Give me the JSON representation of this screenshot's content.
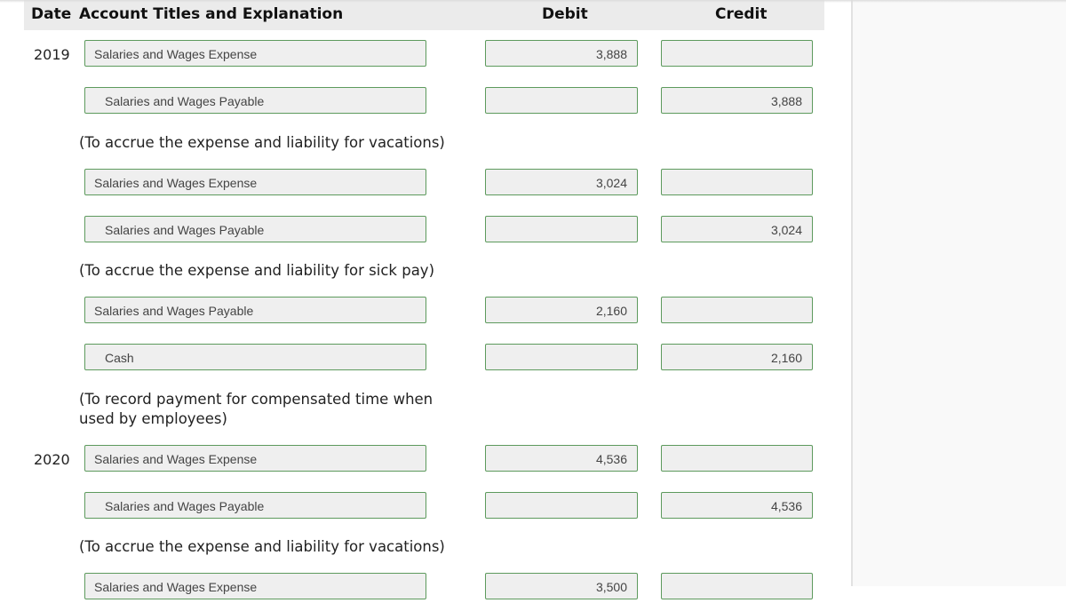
{
  "header": {
    "date": "Date",
    "account": "Account Titles and Explanation",
    "debit": "Debit",
    "credit": "Credit"
  },
  "entries": [
    {
      "date": "2019",
      "account": "Salaries and Wages Expense",
      "debit": "3,888",
      "credit": ""
    },
    {
      "date": "",
      "account": "Salaries and Wages Payable",
      "debit": "",
      "credit": "3,888"
    },
    {
      "explanation": "(To accrue the expense and liability for vacations)"
    },
    {
      "date": "",
      "account": "Salaries and Wages Expense",
      "debit": "3,024",
      "credit": ""
    },
    {
      "date": "",
      "account": "Salaries and Wages Payable",
      "debit": "",
      "credit": "3,024"
    },
    {
      "explanation": "(To accrue the expense and liability for sick pay)"
    },
    {
      "date": "",
      "account": "Salaries and Wages Payable",
      "debit": "2,160",
      "credit": ""
    },
    {
      "date": "",
      "account": "Cash",
      "debit": "",
      "credit": "2,160"
    },
    {
      "explanation": "(To record payment for compensated time when used by employees)"
    },
    {
      "date": "2020",
      "account": "Salaries and Wages Expense",
      "debit": "4,536",
      "credit": ""
    },
    {
      "date": "",
      "account": "Salaries and Wages Payable",
      "debit": "",
      "credit": "4,536"
    },
    {
      "explanation": "(To accrue the expense and liability for vacations)"
    },
    {
      "date": "",
      "account": "Salaries and Wages Expense",
      "debit": "3,500",
      "credit": ""
    }
  ]
}
